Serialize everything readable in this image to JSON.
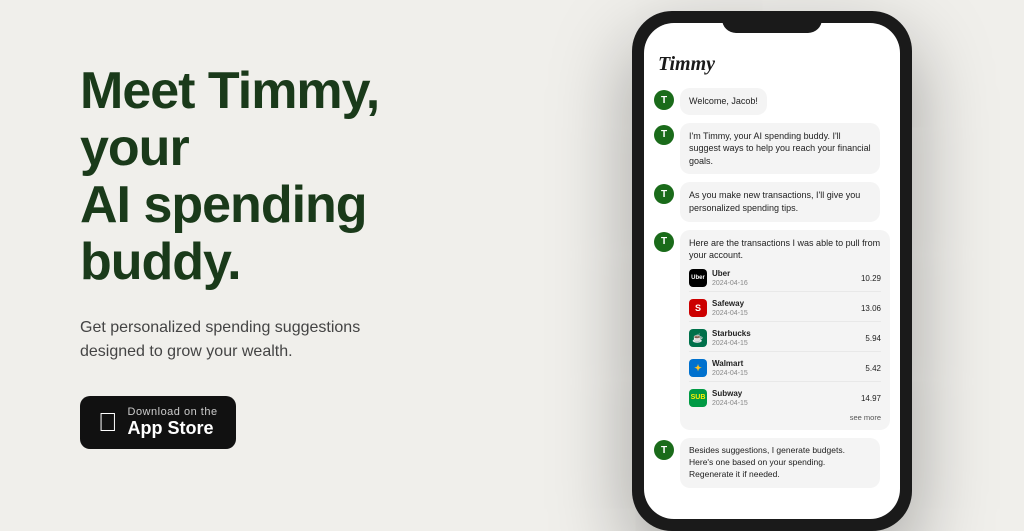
{
  "page": {
    "background": "#f0efeb"
  },
  "left": {
    "headline": "Meet Timmy, your\nAI spending buddy.",
    "headline_line1": "Meet Timmy, your",
    "headline_line2": "AI spending buddy.",
    "subtitle": "Get personalized spending suggestions designed to grow your wealth.",
    "app_store_btn": {
      "download_on": "Download on the",
      "store_name": "App Store",
      "apple_symbol": ""
    }
  },
  "phone": {
    "app_name": "Timmy",
    "chat_messages": [
      {
        "text": "Welcome, Jacob!"
      },
      {
        "text": "I'm Timmy, your AI spending buddy. I'll suggest ways to help you reach your financial goals."
      },
      {
        "text": "As you make new transactions, I'll give you personalized spending tips."
      },
      {
        "text": "Here are the transactions I was able to pull from your account."
      }
    ],
    "transactions": [
      {
        "name": "Uber",
        "date": "2024-04-16",
        "amount": "10.29",
        "color": "#000",
        "abbr": "Uber"
      },
      {
        "name": "Safeway",
        "date": "2024-04-15",
        "amount": "13.06",
        "color": "#e00",
        "abbr": "S"
      },
      {
        "name": "Starbucks",
        "date": "2024-04-15",
        "amount": "5.94",
        "color": "#00704a",
        "abbr": "★"
      },
      {
        "name": "Walmart",
        "date": "2024-04-15",
        "amount": "5.42",
        "color": "#0071ce",
        "abbr": "✦"
      },
      {
        "name": "Subway",
        "date": "2024-04-15",
        "amount": "14.97",
        "color": "#009a44",
        "abbr": "S"
      }
    ],
    "see_more": "see more",
    "bottom_message": "Besides suggestions, I generate budgets. Here's one based on your spending. Regenerate it if needed."
  }
}
